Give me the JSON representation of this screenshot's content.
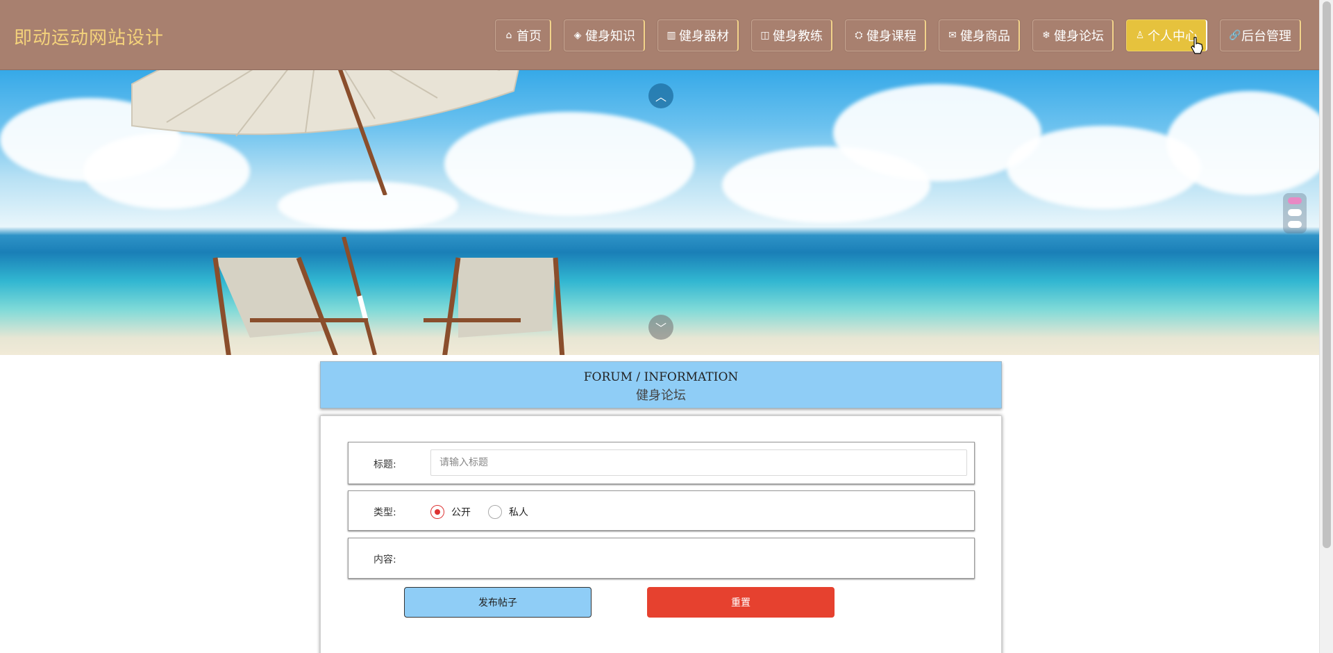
{
  "site": {
    "title": "即动运动网站设计"
  },
  "nav": {
    "items": [
      {
        "icon": "⌂",
        "label": "首页"
      },
      {
        "icon": "◈",
        "label": "健身知识"
      },
      {
        "icon": "▥",
        "label": "健身器材"
      },
      {
        "icon": "◫",
        "label": "健身教练"
      },
      {
        "icon": "⛭",
        "label": "健身课程"
      },
      {
        "icon": "✉",
        "label": "健身商品"
      },
      {
        "icon": "❄",
        "label": "健身论坛"
      },
      {
        "icon": "♙",
        "label": "个人中心"
      },
      {
        "icon": "🔗",
        "label": "后台管理"
      }
    ],
    "active_index": 7
  },
  "banner": {
    "up_icon": "︿",
    "down_icon": "﹀",
    "active_dot": 0
  },
  "forum": {
    "title_en": "FORUM / INFORMATION",
    "title_cn": "健身论坛"
  },
  "form": {
    "title_label": "标题:",
    "title_placeholder": "请输入标题",
    "title_value": "",
    "type_label": "类型:",
    "type_options": [
      "公开",
      "私人"
    ],
    "type_selected": "公开",
    "content_label": "内容:",
    "submit_label": "发布帖子",
    "reset_label": "重置"
  },
  "colors": {
    "header": "#a8806f",
    "site_title": "#f4d27b",
    "active_nav": "#e6c23d",
    "forum_head": "#8fcdf6",
    "reset_button": "#e6412f"
  }
}
